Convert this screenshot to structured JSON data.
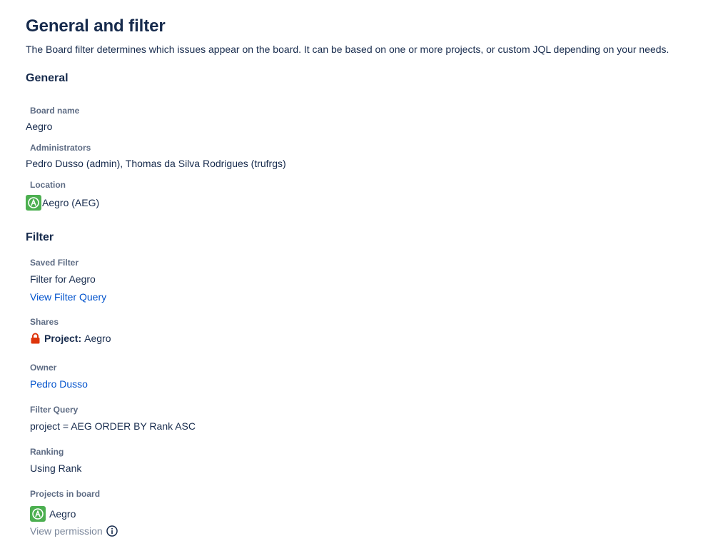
{
  "page": {
    "title": "General and filter",
    "description": "The Board filter determines which issues appear on the board. It can be based on one or more projects, or custom JQL depending on your needs."
  },
  "general": {
    "heading": "General",
    "board_name_label": "Board name",
    "board_name": "Aegro",
    "administrators_label": "Administrators",
    "administrators": "Pedro Dusso (admin), Thomas da Silva Rodrigues (trufrgs)",
    "location_label": "Location",
    "location": "Aegro (AEG)",
    "location_icon": "project-avatar-icon"
  },
  "filter": {
    "heading": "Filter",
    "saved_filter_label": "Saved Filter",
    "saved_filter": "Filter for Aegro",
    "view_query_link": "View Filter Query",
    "shares_label": "Shares",
    "shares_prefix": "Project:",
    "shares_value": "Aegro",
    "shares_icon": "lock-icon",
    "owner_label": "Owner",
    "owner": "Pedro Dusso",
    "query_label": "Filter Query",
    "query": "project = AEG ORDER BY Rank ASC",
    "ranking_label": "Ranking",
    "ranking": "Using Rank",
    "projects_label": "Projects in board",
    "projects": [
      "Aegro"
    ],
    "view_permission": "View permission",
    "info_icon": "info-icon"
  },
  "colors": {
    "text": "#172b4d",
    "label": "#5e6c84",
    "link": "#0052cc",
    "muted": "#7a869a",
    "project_avatar": "#4caf50",
    "lock": "#de350b"
  }
}
